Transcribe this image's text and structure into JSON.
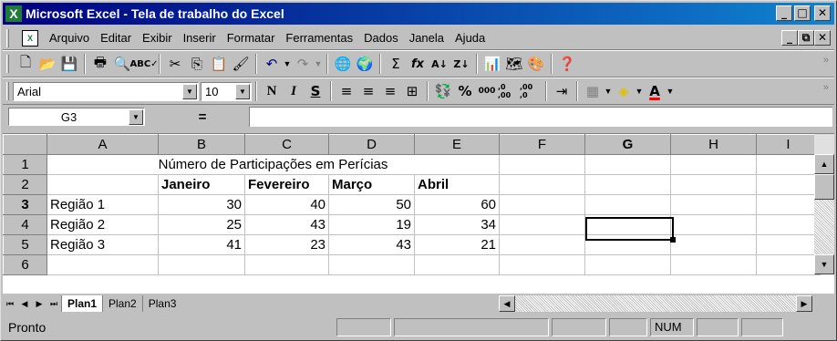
{
  "window": {
    "app_icon": "X",
    "title": "Microsoft Excel - Tela de trabalho do Excel",
    "controls": [
      "_",
      "□",
      "✕"
    ],
    "doc_controls": [
      "_",
      "⧉",
      "✕"
    ]
  },
  "menu": {
    "items": [
      "Arquivo",
      "Editar",
      "Exibir",
      "Inserir",
      "Formatar",
      "Ferramentas",
      "Dados",
      "Janela",
      "Ajuda"
    ]
  },
  "toolbar_standard": {
    "icons": [
      "new-icon",
      "open-icon",
      "save-icon",
      "print-icon",
      "print-preview-icon",
      "spelling-icon",
      "cut-icon",
      "copy-icon",
      "paste-icon",
      "format-painter-icon",
      "undo-icon",
      "redo-icon",
      "hyperlink-icon",
      "web-icon",
      "autosum-icon",
      "function-icon",
      "sort-ascending-icon",
      "sort-descending-icon",
      "chart-wizard-icon",
      "map-icon",
      "drawing-icon",
      "help-icon"
    ],
    "autosum_glyph": "Σ",
    "function_glyph": "fx"
  },
  "toolbar_format": {
    "font": "Arial",
    "size": "10",
    "bold": "N",
    "italic": "I",
    "underline": "S",
    "percent": "%",
    "thousands": "000",
    "inc_decimal": ",0 ,00",
    "dec_decimal": ",00 ,0",
    "font_color_glyph": "A"
  },
  "formula_bar": {
    "name_box": "G3",
    "equals": "=",
    "content": ""
  },
  "sheet": {
    "columns": [
      "A",
      "B",
      "C",
      "D",
      "E",
      "F",
      "G",
      "H",
      "I"
    ],
    "selected_column": "G",
    "selected_row": "3",
    "rows": [
      {
        "n": "1",
        "title": "Número de Participações em Perícias"
      },
      {
        "n": "2",
        "cells": [
          "",
          "Janeiro",
          "Fevereiro",
          "Março",
          "Abril"
        ]
      },
      {
        "n": "3",
        "cells": [
          "Região 1",
          "30",
          "40",
          "50",
          "60"
        ]
      },
      {
        "n": "4",
        "cells": [
          "Região 2",
          "25",
          "43",
          "19",
          "34"
        ]
      },
      {
        "n": "5",
        "cells": [
          "Região 3",
          "41",
          "23",
          "43",
          "21"
        ]
      },
      {
        "n": "6",
        "cells": [
          "",
          "",
          "",
          "",
          ""
        ]
      }
    ]
  },
  "tabs": [
    "Plan1",
    "Plan2",
    "Plan3"
  ],
  "active_tab": "Plan1",
  "status": {
    "text": "Pronto",
    "num": "NUM"
  }
}
